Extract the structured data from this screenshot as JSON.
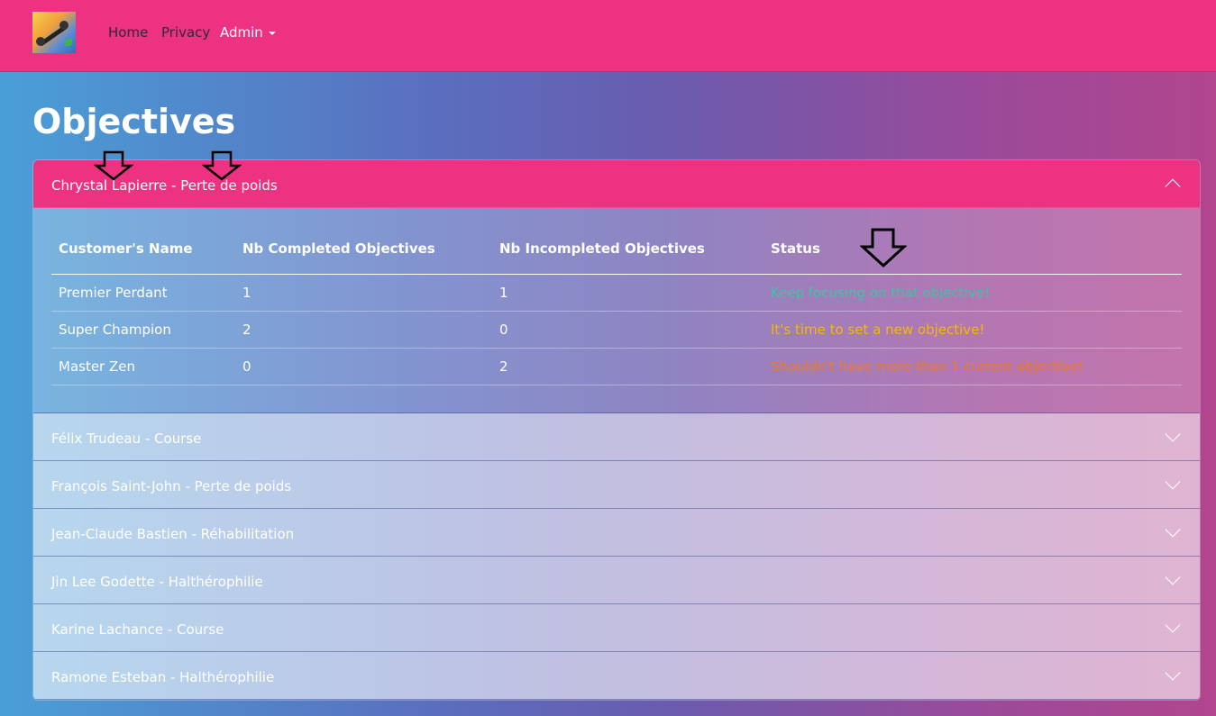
{
  "navbar": {
    "home": "Home",
    "privacy": "Privacy",
    "admin": "Admin"
  },
  "page": {
    "title": "Objectives"
  },
  "accordion": {
    "open": {
      "label": "Chrystal Lapierre - Perte de poids",
      "table": {
        "headers": [
          "Customer's Name",
          "Nb Completed Objectives",
          "Nb Incompleted Objectives",
          "Status"
        ],
        "rows": [
          {
            "name": "Premier Perdant",
            "completed": "1",
            "incompleted": "1",
            "status": "Keep focusing on that objective!",
            "status_color": "#3cc4a4"
          },
          {
            "name": "Super Champion",
            "completed": "2",
            "incompleted": "0",
            "status": "It's time to set a new objective!",
            "status_color": "#f5b800"
          },
          {
            "name": "Master Zen",
            "completed": "0",
            "incompleted": "2",
            "status": "Shouldn't have more than 1 current objective!",
            "status_color": "#f07a20"
          }
        ]
      }
    },
    "closed": [
      "Félix Trudeau - Course",
      "François Saint-John - Perte de poids",
      "Jean-Claude Bastien - Réhabilitation",
      "Jin Lee Godette - Halthérophilie",
      "Karine Lachance - Course",
      "Ramone Esteban - Halthérophilie"
    ]
  }
}
